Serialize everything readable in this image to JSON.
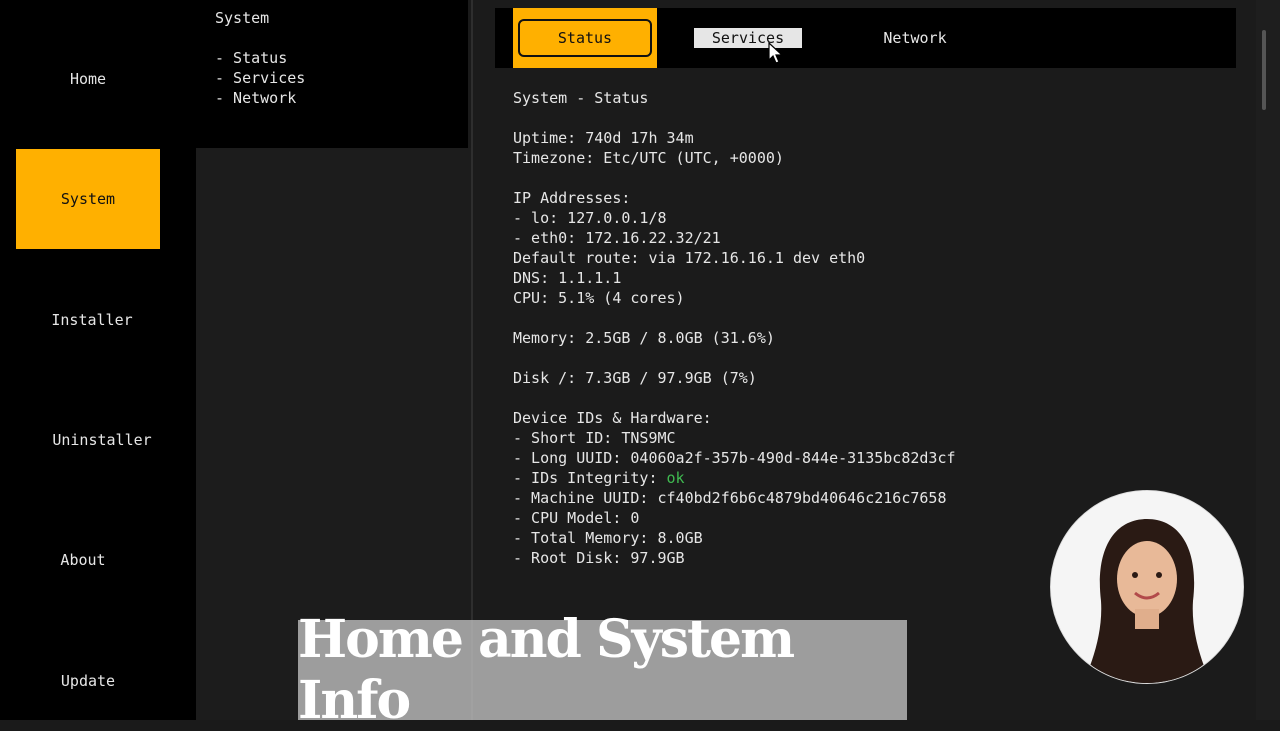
{
  "sidebar": {
    "items": [
      {
        "label": "Home",
        "active": false
      },
      {
        "label": "System",
        "active": true
      },
      {
        "label": "Installer",
        "active": false
      },
      {
        "label": "Uninstaller",
        "active": false
      },
      {
        "label": "About",
        "active": false
      },
      {
        "label": "Update",
        "active": false
      }
    ]
  },
  "submenu": {
    "title": "System",
    "items": [
      "- Status",
      "- Services",
      "- Network"
    ]
  },
  "tabs": [
    {
      "label": "Status",
      "active": true
    },
    {
      "label": "Services",
      "hovered": true
    },
    {
      "label": "Network"
    }
  ],
  "content": {
    "heading": "System - Status",
    "uptime": "Uptime: 740d 17h 34m",
    "timezone": "Timezone: Etc/UTC (UTC, +0000)",
    "ip_title": "IP Addresses:",
    "ip_lo": "- lo: 127.0.0.1/8",
    "ip_eth0": "- eth0: 172.16.22.32/21",
    "route": "Default route: via 172.16.16.1 dev eth0",
    "dns": "DNS: 1.1.1.1",
    "cpu": "CPU: 5.1% (4 cores)",
    "memory": "Memory: 2.5GB / 8.0GB (31.6%)",
    "disk": "Disk /: 7.3GB / 97.9GB (7%)",
    "hw_title": "Device IDs & Hardware:",
    "short_id": "- Short ID: TNS9MC",
    "long_uuid": "- Long UUID: 04060a2f-357b-490d-844e-3135bc82d3cf",
    "integrity_label": "- IDs Integrity: ",
    "integrity_value": "ok",
    "machine_uuid": "- Machine UUID: cf40bd2f6b6c4879bd40646c216c7658",
    "cpu_model": "- CPU Model: 0",
    "total_memory": "- Total Memory: 8.0GB",
    "root_disk": "- Root Disk: 97.9GB"
  },
  "banner": {
    "text": "Home and System Info"
  },
  "colors": {
    "accent": "#ffb000",
    "ok": "#3fb950",
    "background": "#1b1b1b",
    "panel": "#000000"
  },
  "icons": {
    "cursor": "mouse-pointer-icon",
    "avatar": "presenter-avatar"
  }
}
